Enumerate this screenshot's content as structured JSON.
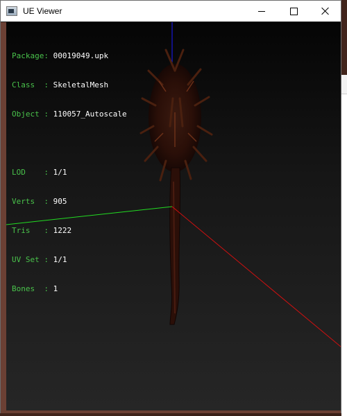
{
  "window": {
    "title": "UE Viewer"
  },
  "info": {
    "package": {
      "key": "Package:",
      "value": "00019049.upk"
    },
    "class": {
      "key": "Class  :",
      "value": "SkeletalMesh"
    },
    "object": {
      "key": "Object :",
      "value": "110057_Autoscale"
    },
    "lod": {
      "key": "LOD    :",
      "value": "1/1"
    },
    "verts": {
      "key": "Verts  :",
      "value": "905"
    },
    "tris": {
      "key": "Tris   :",
      "value": "1222"
    },
    "uvset": {
      "key": "UV Set :",
      "value": "1/1"
    },
    "bones": {
      "key": "Bones  :",
      "value": "1"
    }
  },
  "colors": {
    "label_green": "#49c24b",
    "axis_x": "#d01010",
    "axis_y": "#22dd22",
    "axis_z": "#1a1aff"
  },
  "icons": {
    "app": "ue-viewer-app-icon",
    "minimize": "minimize-icon",
    "maximize": "maximize-icon",
    "close": "close-icon"
  }
}
